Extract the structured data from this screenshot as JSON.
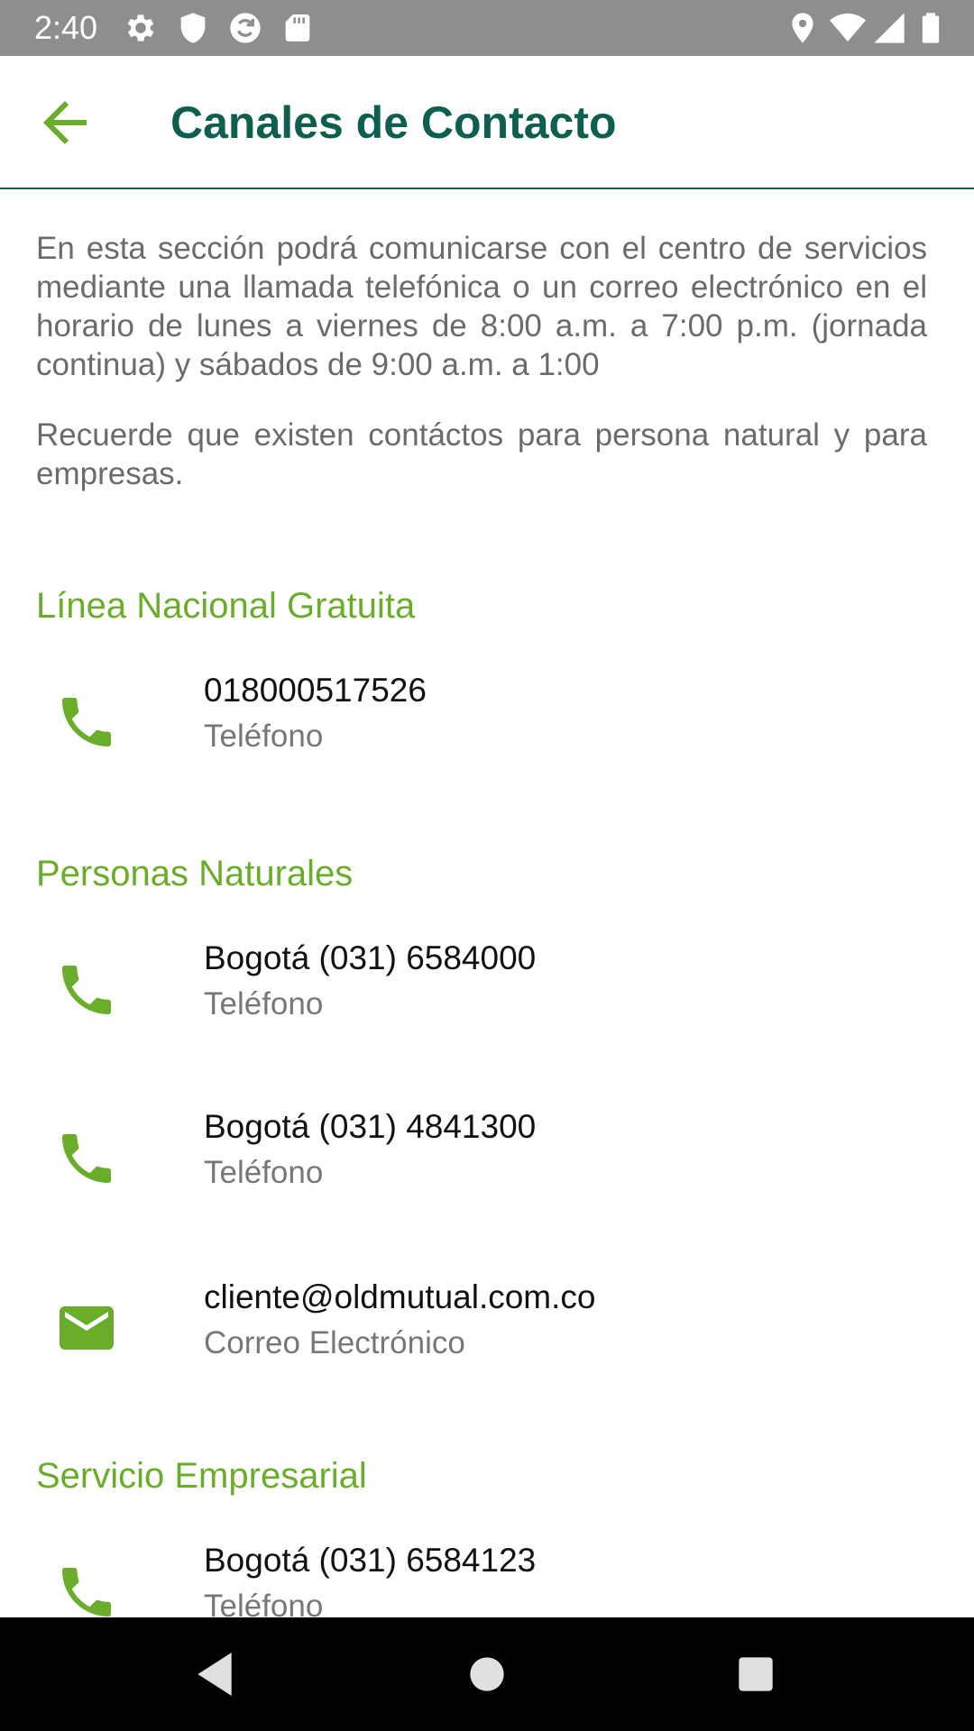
{
  "status_bar": {
    "time": "2:40",
    "background_color": "#8e8e8e",
    "icons": [
      "settings-icon",
      "shield-icon",
      "sync-icon",
      "sd-card-icon",
      "location-icon",
      "wifi-icon",
      "signal-icon",
      "battery-icon"
    ]
  },
  "app_bar": {
    "title": "Canales de Contacto",
    "back_icon": "arrow-left-icon",
    "title_color": "#0e5f50",
    "accent_color": "#6aad2a"
  },
  "intro": {
    "paragraph_1": "En esta sección podrá comunicarse con el centro de servicios mediante una llamada telefónica o un correo electrónico en el horario de lunes a viernes de 8:00 a.m. a 7:00 p.m. (jornada continua) y sábados de 9:00 a.m. a 1:00",
    "paragraph_2": "Recuerde que existen contáctos para persona natural y para empresas."
  },
  "sections": [
    {
      "title": "Línea Nacional Gratuita",
      "items": [
        {
          "icon": "phone-icon",
          "value": "018000517526",
          "label": "Teléfono"
        }
      ]
    },
    {
      "title": "Personas Naturales",
      "items": [
        {
          "icon": "phone-icon",
          "value": "Bogotá (031) 6584000",
          "label": "Teléfono"
        },
        {
          "icon": "phone-icon",
          "value": "Bogotá (031) 4841300",
          "label": "Teléfono"
        },
        {
          "icon": "email-icon",
          "value": "cliente@oldmutual.com.co",
          "label": "Correo Electrónico"
        }
      ]
    },
    {
      "title": "Servicio Empresarial",
      "items": [
        {
          "icon": "phone-icon",
          "value": "Bogotá (031) 6584123",
          "label": "Teléfono"
        }
      ]
    }
  ],
  "nav_bar": {
    "icons": [
      "back-triangle-icon",
      "home-circle-icon",
      "recents-square-icon"
    ]
  }
}
